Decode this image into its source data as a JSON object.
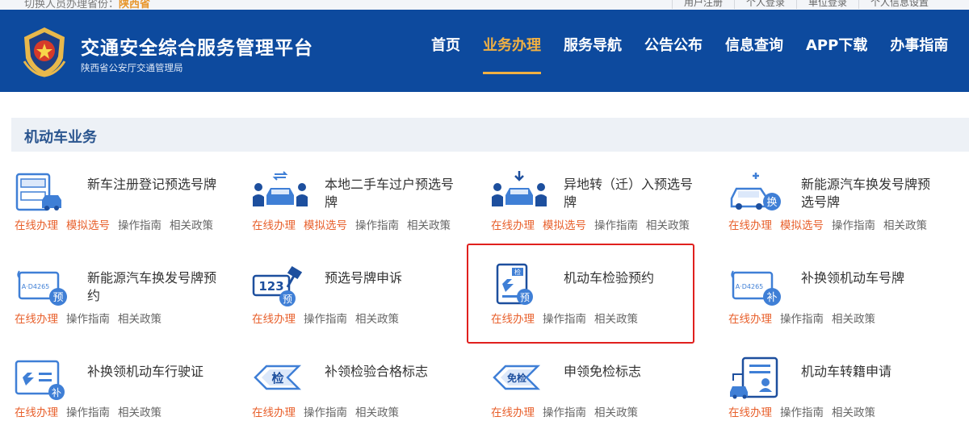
{
  "topbar": {
    "region_prefix": "切换人员办理省份：",
    "region_value": "陕西省",
    "links": [
      "用户注册",
      "个人登录",
      "单位登录",
      "个人信息设置"
    ]
  },
  "header": {
    "title": "交通安全综合服务管理平台",
    "subtitle": "陕西省公安厅交通管理局",
    "nav": [
      "首页",
      "业务办理",
      "服务导航",
      "公告公布",
      "信息查询",
      "APP下载",
      "办事指南"
    ],
    "active_nav": "业务办理"
  },
  "section": {
    "title": "机动车业务"
  },
  "services": [
    {
      "name": "新车注册登记预选号牌",
      "links": [
        "在线办理",
        "模拟选号",
        "操作指南",
        "相关政策"
      ]
    },
    {
      "name": "本地二手车过户预选号牌",
      "links": [
        "在线办理",
        "模拟选号",
        "操作指南",
        "相关政策"
      ]
    },
    {
      "name": "异地转（迁）入预选号牌",
      "links": [
        "在线办理",
        "模拟选号",
        "操作指南",
        "相关政策"
      ]
    },
    {
      "name": "新能源汽车换发号牌预选号牌",
      "links": [
        "在线办理",
        "模拟选号",
        "操作指南",
        "相关政策"
      ]
    },
    {
      "name": "新能源汽车换发号牌预约",
      "links": [
        "在线办理",
        "操作指南",
        "相关政策"
      ]
    },
    {
      "name": "预选号牌申诉",
      "links": [
        "在线办理",
        "操作指南",
        "相关政策"
      ]
    },
    {
      "name": "机动车检验预约",
      "links": [
        "在线办理",
        "操作指南",
        "相关政策"
      ]
    },
    {
      "name": "补换领机动车号牌",
      "links": [
        "在线办理",
        "操作指南",
        "相关政策"
      ]
    },
    {
      "name": "补换领机动车行驶证",
      "links": [
        "在线办理",
        "操作指南",
        "相关政策"
      ]
    },
    {
      "name": "补领检验合格标志",
      "links": [
        "在线办理",
        "操作指南",
        "相关政策"
      ]
    },
    {
      "name": "申领免检标志",
      "links": [
        "在线办理",
        "操作指南",
        "相关政策"
      ]
    },
    {
      "name": "机动车转籍申请",
      "links": [
        "在线办理",
        "操作指南",
        "相关政策"
      ]
    }
  ],
  "icons": {
    "badge_yu": "预",
    "badge_huan": "换",
    "badge_bu": "补",
    "badge_jian": "检",
    "plate_text": "A·D4265",
    "num_123": "123",
    "tag_jian": "检",
    "tag_mianjian": "免检"
  },
  "colors": {
    "header_bg": "#0d4a9e",
    "accent": "#f0b043",
    "link_orange": "#e8602c",
    "icon_blue": "#3f7fd6",
    "highlight": "#e0201e"
  }
}
